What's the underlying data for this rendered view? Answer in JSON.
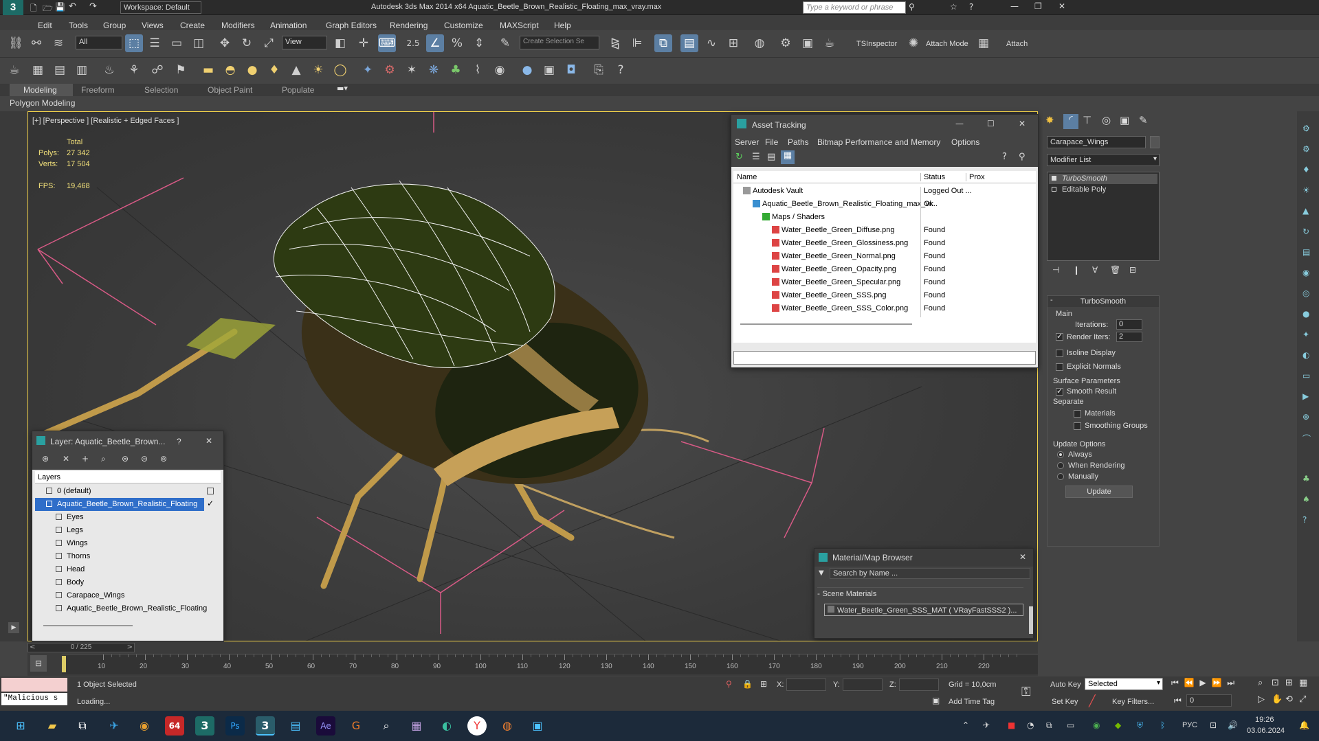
{
  "titlebar": {
    "workspace_label": "Workspace: Default",
    "title": "Autodesk 3ds Max  2014 x64     Aquatic_Beetle_Brown_Realistic_Floating_max_vray.max",
    "search_placeholder": "Type a keyword or phrase"
  },
  "menu": [
    "Edit",
    "Tools",
    "Group",
    "Views",
    "Create",
    "Modifiers",
    "Animation",
    "Graph Editors",
    "Rendering",
    "Customize",
    "MAXScript",
    "Help"
  ],
  "toolbar": {
    "filter_value": "All",
    "refcoord_value": "View",
    "snap_value": "2.5",
    "selection_set_placeholder": "Create Selection Se",
    "tsinspector": "TSInspector",
    "attach_mode": "Attach Mode",
    "attach": "Attach"
  },
  "ribbon": {
    "tabs": [
      "Modeling",
      "Freeform",
      "Selection",
      "Object Paint",
      "Populate"
    ],
    "sub": "Polygon Modeling"
  },
  "viewport": {
    "label": "[+] [Perspective ] [Realistic + Edged Faces ]",
    "stats_header": "Total",
    "polys_label": "Polys:",
    "polys_value": "27 342",
    "verts_label": "Verts:",
    "verts_value": "17 504",
    "fps_label": "FPS:",
    "fps_value": "19,468"
  },
  "asset_tracking": {
    "title": "Asset Tracking",
    "menu": [
      "Server",
      "File",
      "Paths",
      "Bitmap Performance and Memory",
      "Options"
    ],
    "columns": [
      "Name",
      "Status",
      "Prox"
    ],
    "rows": [
      {
        "name": "Autodesk Vault",
        "status": "Logged Out ...",
        "indent": 0,
        "icon": "vault"
      },
      {
        "name": "Aquatic_Beetle_Brown_Realistic_Floating_max_vr...",
        "status": "Ok",
        "indent": 1,
        "icon": "file"
      },
      {
        "name": "Maps / Shaders",
        "status": "",
        "indent": 2,
        "icon": "maps"
      },
      {
        "name": "Water_Beetle_Green_Diffuse.png",
        "status": "Found",
        "indent": 3,
        "icon": "png"
      },
      {
        "name": "Water_Beetle_Green_Glossiness.png",
        "status": "Found",
        "indent": 3,
        "icon": "png"
      },
      {
        "name": "Water_Beetle_Green_Normal.png",
        "status": "Found",
        "indent": 3,
        "icon": "png"
      },
      {
        "name": "Water_Beetle_Green_Opacity.png",
        "status": "Found",
        "indent": 3,
        "icon": "png"
      },
      {
        "name": "Water_Beetle_Green_Specular.png",
        "status": "Found",
        "indent": 3,
        "icon": "png"
      },
      {
        "name": "Water_Beetle_Green_SSS.png",
        "status": "Found",
        "indent": 3,
        "icon": "png"
      },
      {
        "name": "Water_Beetle_Green_SSS_Color.png",
        "status": "Found",
        "indent": 3,
        "icon": "png"
      }
    ]
  },
  "layer_panel": {
    "title": "Layer: Aquatic_Beetle_Brown...",
    "help": "?",
    "header": "Layers",
    "items": [
      {
        "label": "0 (default)",
        "indent": 0,
        "selected": false
      },
      {
        "label": "Aquatic_Beetle_Brown_Realistic_Floating",
        "indent": 0,
        "selected": true
      },
      {
        "label": "Eyes",
        "indent": 1,
        "selected": false
      },
      {
        "label": "Legs",
        "indent": 1,
        "selected": false
      },
      {
        "label": "Wings",
        "indent": 1,
        "selected": false
      },
      {
        "label": "Thorns",
        "indent": 1,
        "selected": false
      },
      {
        "label": "Head",
        "indent": 1,
        "selected": false
      },
      {
        "label": "Body",
        "indent": 1,
        "selected": false
      },
      {
        "label": "Carapace_Wings",
        "indent": 1,
        "selected": false
      },
      {
        "label": "Aquatic_Beetle_Brown_Realistic_Floating",
        "indent": 1,
        "selected": false
      }
    ]
  },
  "material_browser": {
    "title": "Material/Map Browser",
    "search_placeholder": "Search by Name ...",
    "section": "Scene Materials",
    "material": "Water_Beetle_Green_SSS_MAT  ( VRayFastSSS2 )..."
  },
  "command_panel": {
    "object_name": "Carapace_Wings",
    "modifier_list": "Modifier List",
    "stack": [
      "TurboSmooth",
      "Editable Poly"
    ],
    "rollout_title": "TurboSmooth",
    "main_group": "Main",
    "iterations_label": "Iterations:",
    "iterations_value": "0",
    "render_iters_label": "Render Iters:",
    "render_iters_value": "2",
    "isoline_label": "Isoline Display",
    "explicit_normals_label": "Explicit Normals",
    "surface_group": "Surface Parameters",
    "smooth_result_label": "Smooth Result",
    "separate_label": "Separate",
    "materials_label": "Materials",
    "smoothing_groups_label": "Smoothing Groups",
    "update_group": "Update Options",
    "always_label": "Always",
    "when_rendering_label": "When Rendering",
    "manually_label": "Manually",
    "update_button": "Update"
  },
  "timeline": {
    "frame_counter": "0 / 225",
    "ticks": [
      "10",
      "20",
      "30",
      "40",
      "50",
      "60",
      "70",
      "80",
      "90",
      "100",
      "110",
      "120",
      "130",
      "140",
      "150",
      "160",
      "170",
      "180",
      "190",
      "200",
      "210",
      "220"
    ]
  },
  "status": {
    "maxscript_text": "\"Malicious s",
    "selected_text": "1 Object Selected",
    "loading_text": "Loading...",
    "x_label": "X:",
    "y_label": "Y:",
    "z_label": "Z:",
    "grid_text": "Grid = 10,0cm",
    "add_time_tag": "Add Time Tag",
    "auto_key": "Auto Key",
    "set_key": "Set Key",
    "selected_dropdown": "Selected",
    "key_filters": "Key Filters...",
    "frame_value": "0"
  },
  "taskbar": {
    "lang": "РУС",
    "time": "19:26",
    "date": "03.06.2024",
    "badge": "64"
  },
  "colors": {
    "accent_blue": "#5c7fa3",
    "viewport_border": "#f3d34a",
    "selection_blue": "#2f6ec9",
    "grid_pink": "#d85a86"
  }
}
